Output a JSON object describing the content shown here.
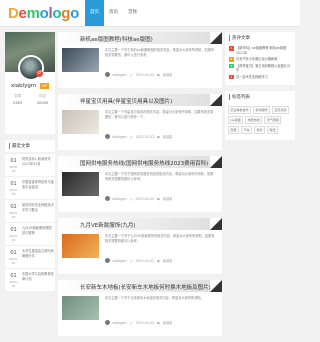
{
  "header": {
    "logo_letters": [
      {
        "ch": "D",
        "color": "#f2a43b"
      },
      {
        "ch": "e",
        "color": "#e84c3d"
      },
      {
        "ch": "m",
        "color": "#2ecc71"
      },
      {
        "ch": "o",
        "color": "#3498db"
      },
      {
        "ch": "l",
        "color": "#9b59b6"
      },
      {
        "ch": "o",
        "color": "#1abc9c"
      },
      {
        "ch": "g",
        "color": "#e67e22"
      },
      {
        "ch": "o",
        "color": "#2a9bd8"
      }
    ],
    "nav": [
      "首页",
      "资讯",
      "音频"
    ]
  },
  "profile": {
    "badge": "♂",
    "username": "xiablygm",
    "level": "VIP",
    "stats": [
      {
        "label": "文章",
        "value": "5383"
      },
      {
        "label": "评论",
        "value": "40009"
      }
    ]
  },
  "recent": {
    "title": "最近文章",
    "items": [
      {
        "day": "01",
        "month": "2023-03",
        "text": "财务目标1·新闻资讯2023年03月"
      },
      {
        "day": "01",
        "month": "2023-03",
        "text": "中国宝宝体育投资与宝宝平台建设"
      },
      {
        "day": "02",
        "month": "2023-03",
        "text": "如何学好农业种植技术中学习要点"
      },
      {
        "day": "01",
        "month": "2023-03",
        "text": "九月VE新款服饰搭配技巧推荐"
      },
      {
        "day": "01",
        "month": "2023-03",
        "text": "大学生基金会日常时间管理分享"
      },
      {
        "day": "01",
        "month": "2023-03",
        "text": "中国大学与高校教育改革计划"
      }
    ]
  },
  "posts": [
    {
      "title": "新机ae版图教程(科技ae版图)",
      "excerpt": "本文主要一下关于新机ae版图教程的相关内容，希望对大家有所帮助，如果有相关需要的，都可以进行参考。",
      "author": "xiablygm",
      "date": "2023-03-02",
      "views": "阅读量",
      "thumb_colors": [
        "#3b4a5a",
        "#9aa6b2"
      ]
    },
    {
      "title": "伴星宝贝用具(伴星宝贝用具以及图片)",
      "excerpt": "本文主要一下伴星宝贝用具的相关内容，希望对大家有所帮助，如果有相关需要的，都可以进行参考一下。",
      "author": "xiablygm",
      "date": "2023-03-02",
      "views": "阅读量",
      "thumb_colors": [
        "#c8c2b6",
        "#eeeae2"
      ]
    },
    {
      "title": "国网供电服务热线(国网供电服务热线2023费用百科)",
      "excerpt": "本文主要一下关于国网供电服务热线的相关内容，希望对大家有所帮助，如果有相关需要的都可以参考。",
      "author": "xiablygm",
      "date": "2023-03-02",
      "views": "阅读量",
      "thumb_colors": [
        "#2a2a2a",
        "#6b6b6b"
      ]
    },
    {
      "title": "九月VE新款服饰(九月)",
      "excerpt": "本文主要一下关于九月VE新款服饰的相关内容，希望对大家有所帮助，如果有相关需要的都可以参考。",
      "author": "xiablygm",
      "date": "2023-03-02",
      "views": "阅读量",
      "thumb_colors": [
        "#d96a1c",
        "#f3b25a"
      ]
    },
    {
      "title": "长安新车木地板(长安新车木地板何时换木地板及图片)",
      "excerpt": "本文主要一下关于长安新车木地板的相关内容，希望对大家有所帮助。",
      "author": "xiablygm",
      "date": "2023-03-02",
      "views": "阅读量",
      "thumb_colors": [
        "#6f8f7c",
        "#a8c0b0"
      ]
    }
  ],
  "hot": {
    "title": "热评文章",
    "items": [
      "【新材料】ae版图教程·新机ae版图2021年",
      "长安汽车小车图片及价格新款",
      "【帮帮宝贝】宝贝用具教程以及图片分享",
      "这一技术农业种植学习"
    ]
  },
  "tags": {
    "title": "标签列表",
    "items": [
      "农业种植技术",
      "新款服饰",
      "宝贝用具",
      "jsp版图",
      "电费热线",
      "天气预报",
      "家居",
      "汽车",
      "体育",
      "财经"
    ]
  }
}
